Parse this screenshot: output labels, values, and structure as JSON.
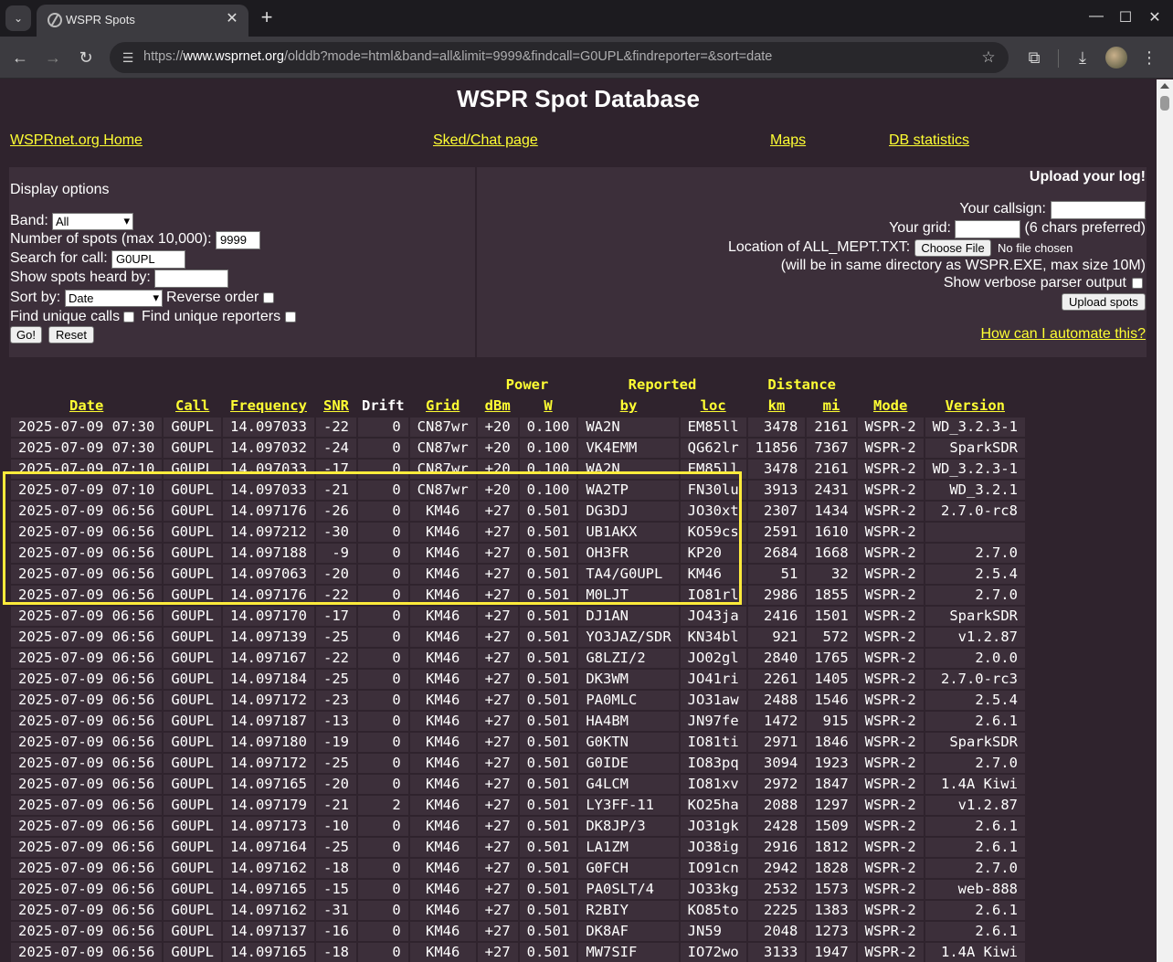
{
  "browser": {
    "tab_title": "WSPR Spots",
    "url_prefix": "https://",
    "url_host": "www.wsprnet.org",
    "url_path": "/olddb?mode=html&band=all&limit=9999&findcall=G0UPL&findreporter=&sort=date"
  },
  "page": {
    "title": "WSPR Spot Database",
    "nav": [
      "WSPRnet.org Home",
      "Sked/Chat page",
      "Maps",
      "DB statistics"
    ]
  },
  "options": {
    "heading": "Display options",
    "band_label": "Band:",
    "band_value": "All",
    "num_spots_label": "Number of spots (max 10,000):",
    "num_spots_value": "9999",
    "search_call_label": "Search for call:",
    "search_call_value": "G0UPL",
    "heard_by_label": "Show spots heard by:",
    "heard_by_value": "",
    "sort_label": "Sort by:",
    "sort_value": "Date",
    "reverse_label": "Reverse order",
    "unique_calls_label": "Find unique calls",
    "unique_reporters_label": "Find unique reporters",
    "go_label": "Go!",
    "reset_label": "Reset"
  },
  "upload": {
    "heading": "Upload your log!",
    "callsign_label": "Your callsign:",
    "grid_label": "Your grid:",
    "grid_hint": "(6 chars preferred)",
    "location_label": "Location of ALL_MEPT.TXT:",
    "choose_file_label": "Choose File",
    "no_file_label": "No file chosen",
    "note": "(will be in same directory as WSPR.EXE, max size 10M)",
    "verbose_label": "Show verbose parser output",
    "upload_button": "Upload spots",
    "automate_link": "How can I automate this?"
  },
  "table": {
    "group_headers": {
      "power": "Power",
      "reported": "Reported",
      "distance": "Distance"
    },
    "columns": [
      "Date",
      "Call",
      "Frequency",
      "SNR",
      "Drift",
      "Grid",
      "dBm",
      "W",
      "by",
      "loc",
      "km",
      "mi",
      "Mode",
      "Version"
    ],
    "rows": [
      [
        "2025-07-09 07:30",
        "G0UPL",
        "14.097033",
        "-22",
        "0",
        "CN87wr",
        "+20",
        "0.100",
        "WA2N",
        "EM85ll",
        "3478",
        "2161",
        "WSPR-2",
        "WD_3.2.3-1"
      ],
      [
        "2025-07-09 07:30",
        "G0UPL",
        "14.097032",
        "-24",
        "0",
        "CN87wr",
        "+20",
        "0.100",
        "VK4EMM",
        "QG62lr",
        "11856",
        "7367",
        "WSPR-2",
        "SparkSDR"
      ],
      [
        "2025-07-09 07:10",
        "G0UPL",
        "14.097033",
        "-17",
        "0",
        "CN87wr",
        "+20",
        "0.100",
        "WA2N",
        "EM85ll",
        "3478",
        "2161",
        "WSPR-2",
        "WD_3.2.3-1"
      ],
      [
        "2025-07-09 07:10",
        "G0UPL",
        "14.097033",
        "-21",
        "0",
        "CN87wr",
        "+20",
        "0.100",
        "WA2TP",
        "FN30lu",
        "3913",
        "2431",
        "WSPR-2",
        "WD_3.2.1"
      ],
      [
        "2025-07-09 06:56",
        "G0UPL",
        "14.097176",
        "-26",
        "0",
        "KM46",
        "+27",
        "0.501",
        "DG3DJ",
        "JO30xt",
        "2307",
        "1434",
        "WSPR-2",
        "2.7.0-rc8"
      ],
      [
        "2025-07-09 06:56",
        "G0UPL",
        "14.097212",
        "-30",
        "0",
        "KM46",
        "+27",
        "0.501",
        "UB1AKX",
        "KO59cs",
        "2591",
        "1610",
        "WSPR-2",
        ""
      ],
      [
        "2025-07-09 06:56",
        "G0UPL",
        "14.097188",
        "-9",
        "0",
        "KM46",
        "+27",
        "0.501",
        "OH3FR",
        "KP20",
        "2684",
        "1668",
        "WSPR-2",
        "2.7.0"
      ],
      [
        "2025-07-09 06:56",
        "G0UPL",
        "14.097063",
        "-20",
        "0",
        "KM46",
        "+27",
        "0.501",
        "TA4/G0UPL",
        "KM46",
        "51",
        "32",
        "WSPR-2",
        "2.5.4"
      ],
      [
        "2025-07-09 06:56",
        "G0UPL",
        "14.097176",
        "-22",
        "0",
        "KM46",
        "+27",
        "0.501",
        "M0LJT",
        "IO81rl",
        "2986",
        "1855",
        "WSPR-2",
        "2.7.0"
      ],
      [
        "2025-07-09 06:56",
        "G0UPL",
        "14.097170",
        "-17",
        "0",
        "KM46",
        "+27",
        "0.501",
        "DJ1AN",
        "JO43ja",
        "2416",
        "1501",
        "WSPR-2",
        "SparkSDR"
      ],
      [
        "2025-07-09 06:56",
        "G0UPL",
        "14.097139",
        "-25",
        "0",
        "KM46",
        "+27",
        "0.501",
        "YO3JAZ/SDR",
        "KN34bl",
        "921",
        "572",
        "WSPR-2",
        "v1.2.87"
      ],
      [
        "2025-07-09 06:56",
        "G0UPL",
        "14.097167",
        "-22",
        "0",
        "KM46",
        "+27",
        "0.501",
        "G8LZI/2",
        "JO02gl",
        "2840",
        "1765",
        "WSPR-2",
        "2.0.0"
      ],
      [
        "2025-07-09 06:56",
        "G0UPL",
        "14.097184",
        "-25",
        "0",
        "KM46",
        "+27",
        "0.501",
        "DK3WM",
        "JO41ri",
        "2261",
        "1405",
        "WSPR-2",
        "2.7.0-rc3"
      ],
      [
        "2025-07-09 06:56",
        "G0UPL",
        "14.097172",
        "-23",
        "0",
        "KM46",
        "+27",
        "0.501",
        "PA0MLC",
        "JO31aw",
        "2488",
        "1546",
        "WSPR-2",
        "2.5.4"
      ],
      [
        "2025-07-09 06:56",
        "G0UPL",
        "14.097187",
        "-13",
        "0",
        "KM46",
        "+27",
        "0.501",
        "HA4BM",
        "JN97fe",
        "1472",
        "915",
        "WSPR-2",
        "2.6.1"
      ],
      [
        "2025-07-09 06:56",
        "G0UPL",
        "14.097180",
        "-19",
        "0",
        "KM46",
        "+27",
        "0.501",
        "G0KTN",
        "IO81ti",
        "2971",
        "1846",
        "WSPR-2",
        "SparkSDR"
      ],
      [
        "2025-07-09 06:56",
        "G0UPL",
        "14.097172",
        "-25",
        "0",
        "KM46",
        "+27",
        "0.501",
        "G0IDE",
        "IO83pq",
        "3094",
        "1923",
        "WSPR-2",
        "2.7.0"
      ],
      [
        "2025-07-09 06:56",
        "G0UPL",
        "14.097165",
        "-20",
        "0",
        "KM46",
        "+27",
        "0.501",
        "G4LCM",
        "IO81xv",
        "2972",
        "1847",
        "WSPR-2",
        "1.4A Kiwi"
      ],
      [
        "2025-07-09 06:56",
        "G0UPL",
        "14.097179",
        "-21",
        "2",
        "KM46",
        "+27",
        "0.501",
        "LY3FF-11",
        "KO25ha",
        "2088",
        "1297",
        "WSPR-2",
        "v1.2.87"
      ],
      [
        "2025-07-09 06:56",
        "G0UPL",
        "14.097173",
        "-10",
        "0",
        "KM46",
        "+27",
        "0.501",
        "DK8JP/3",
        "JO31gk",
        "2428",
        "1509",
        "WSPR-2",
        "2.6.1"
      ],
      [
        "2025-07-09 06:56",
        "G0UPL",
        "14.097164",
        "-25",
        "0",
        "KM46",
        "+27",
        "0.501",
        "LA1ZM",
        "JO38ig",
        "2916",
        "1812",
        "WSPR-2",
        "2.6.1"
      ],
      [
        "2025-07-09 06:56",
        "G0UPL",
        "14.097162",
        "-18",
        "0",
        "KM46",
        "+27",
        "0.501",
        "G0FCH",
        "IO91cn",
        "2942",
        "1828",
        "WSPR-2",
        "2.7.0"
      ],
      [
        "2025-07-09 06:56",
        "G0UPL",
        "14.097165",
        "-15",
        "0",
        "KM46",
        "+27",
        "0.501",
        "PA0SLT/4",
        "JO33kg",
        "2532",
        "1573",
        "WSPR-2",
        "web-888"
      ],
      [
        "2025-07-09 06:56",
        "G0UPL",
        "14.097162",
        "-31",
        "0",
        "KM46",
        "+27",
        "0.501",
        "R2BIY",
        "KO85to",
        "2225",
        "1383",
        "WSPR-2",
        "2.6.1"
      ],
      [
        "2025-07-09 06:56",
        "G0UPL",
        "14.097137",
        "-16",
        "0",
        "KM46",
        "+27",
        "0.501",
        "DK8AF",
        "JN59",
        "2048",
        "1273",
        "WSPR-2",
        "2.6.1"
      ],
      [
        "2025-07-09 06:56",
        "G0UPL",
        "14.097165",
        "-18",
        "0",
        "KM46",
        "+27",
        "0.501",
        "MW7SIF",
        "IO72wo",
        "3133",
        "1947",
        "WSPR-2",
        "1.4A Kiwi"
      ]
    ]
  }
}
